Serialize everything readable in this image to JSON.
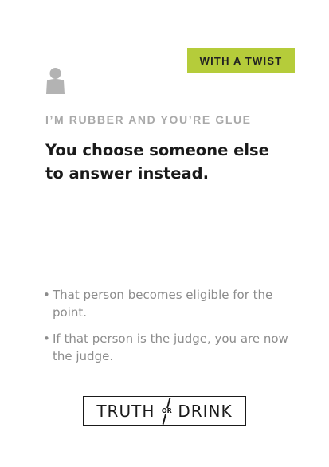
{
  "card": {
    "badge": "WITH A TWIST",
    "subtitle": "I’M RUBBER AND YOU’RE GLUE",
    "title": "You choose someone else to answer instead.",
    "rules": [
      "That person becomes eligible for the point.",
      "If that person is the judge, you are now the judge."
    ],
    "bullet": "•",
    "icon": "person-icon"
  },
  "logo": {
    "left": "TRUTH",
    "or": "OR",
    "right": "DRINK"
  },
  "colors": {
    "badge_bg": "#b5cc3a",
    "subtitle": "#a9a9a9",
    "title": "#1a1a1a",
    "rules": "#8c8c8c"
  }
}
